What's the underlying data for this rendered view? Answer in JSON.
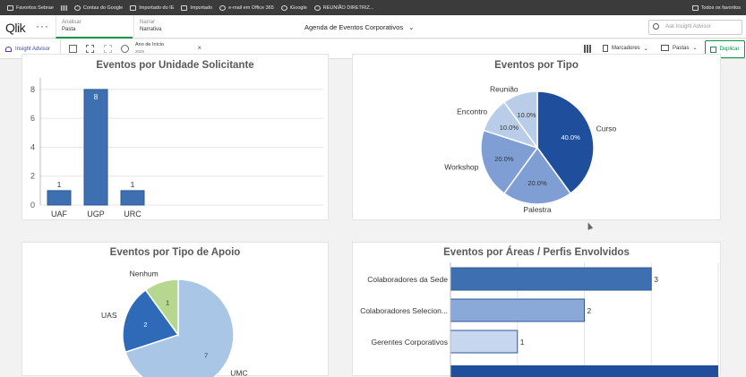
{
  "bookmarks": {
    "items": [
      {
        "label": "Favoritos Sebrae",
        "icon": "folder-icon"
      },
      {
        "label": "",
        "icon": "apps-icon"
      },
      {
        "label": "Contas do Google",
        "icon": "globe-icon"
      },
      {
        "label": "Importado do IE",
        "icon": "folder-icon"
      },
      {
        "label": "Importado",
        "icon": "folder-icon"
      },
      {
        "label": "e-mail em Office 365",
        "icon": "globe-icon"
      },
      {
        "label": "iGoogle",
        "icon": "globe-icon"
      },
      {
        "label": "REUNIÃO DIRETRIZ...",
        "icon": "globe-icon"
      }
    ],
    "all_favorites": "Todos os favoritos"
  },
  "header": {
    "logo": "Qlik",
    "menu": "···",
    "tabs": [
      {
        "small": "Analisar",
        "big": "Pasta"
      },
      {
        "small": "Narrar",
        "big": "Narrativa"
      }
    ],
    "app_title": "Agenda de Eventos Corporativos",
    "search_placeholder": "Ask Insight Advisor"
  },
  "toolbar": {
    "insight_advisor": "Insight Advisor",
    "filter_label": "Ano de Início",
    "filter_value": "2025",
    "bookmarks": "Marcadores",
    "sheets": "Pastas",
    "duplicate": "Duplicar"
  },
  "colors": {
    "accent": "#009845",
    "bar": "#3e6fb0",
    "pie_dark": "#1f4e9c",
    "pie_mid": "#7f9fd4",
    "pie_light": "#b9cde8",
    "pie_green": "#b6d78f",
    "pie_apoio_main": "#a9c6e6",
    "pie_apoio_uas": "#2f6ab8"
  },
  "chart_data": [
    {
      "type": "bar",
      "title": "Eventos por Unidade Solicitante",
      "categories": [
        "UAF",
        "UGP",
        "URC"
      ],
      "values": [
        1,
        8,
        1
      ],
      "yticks": [
        0,
        2,
        4,
        6,
        8
      ],
      "ylim": [
        0,
        8.8
      ],
      "grid": true
    },
    {
      "type": "pie",
      "title": "Eventos por Tipo",
      "labels": [
        "Curso",
        "Palestra",
        "Workshop",
        "Encontro",
        "Reunião"
      ],
      "values": [
        40,
        20,
        20,
        10,
        10
      ],
      "value_labels": [
        "40.0%",
        "20.0%",
        "20.0%",
        "10.0%",
        "10.0%"
      ]
    },
    {
      "type": "pie",
      "title": "Eventos por Tipo de Apoio",
      "labels": [
        "UMC",
        "UAS",
        "Nenhum"
      ],
      "values": [
        7,
        2,
        1
      ],
      "value_labels": [
        "7",
        "2",
        "1"
      ]
    },
    {
      "type": "bar",
      "orientation": "horizontal",
      "title": "Eventos por Áreas / Perfis Envolvidos",
      "categories": [
        "Colaboradores da Sede",
        "Colaboradores Selecion...",
        "Gerentes Corporativos"
      ],
      "values": [
        3,
        2,
        1
      ],
      "xlim": [
        0,
        4
      ],
      "grid": true
    }
  ]
}
